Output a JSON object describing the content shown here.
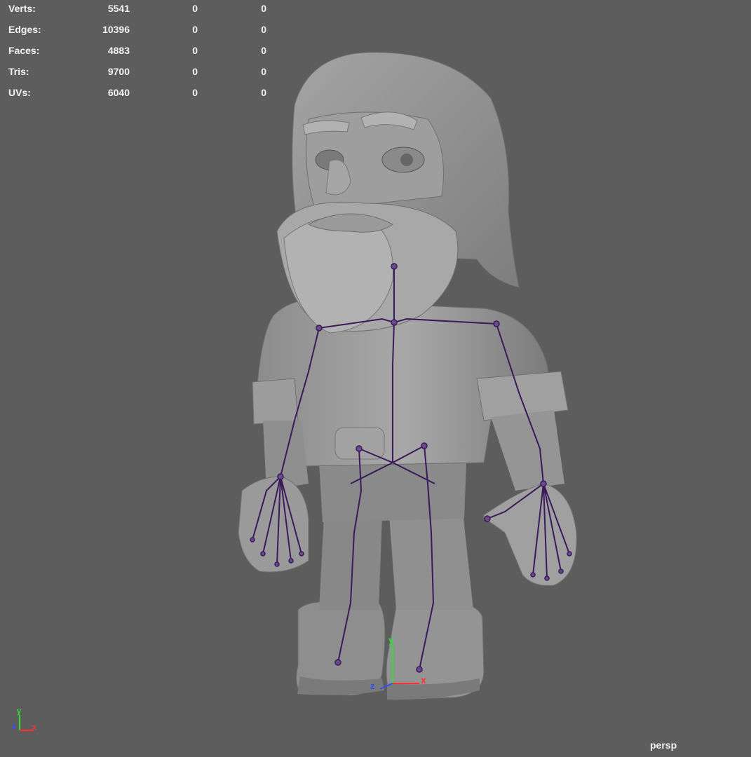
{
  "hud": {
    "rows": [
      {
        "label": "Verts:",
        "v1": "5541",
        "v2": "0",
        "v3": "0"
      },
      {
        "label": "Edges:",
        "v1": "10396",
        "v2": "0",
        "v3": "0"
      },
      {
        "label": "Faces:",
        "v1": "4883",
        "v2": "0",
        "v3": "0"
      },
      {
        "label": "Tris:",
        "v1": "9700",
        "v2": "0",
        "v3": "0"
      },
      {
        "label": "UVs:",
        "v1": "6040",
        "v2": "0",
        "v3": "0"
      }
    ]
  },
  "camera": {
    "name": "persp"
  },
  "axes": {
    "x": "x",
    "y": "y",
    "z": "z"
  },
  "colors": {
    "background": "#5d5d5d",
    "mesh": "#9a9a9a",
    "skeleton": "#3a1a5a",
    "axis_x": "#ff3030",
    "axis_y": "#30e030",
    "axis_z": "#3050ff"
  }
}
